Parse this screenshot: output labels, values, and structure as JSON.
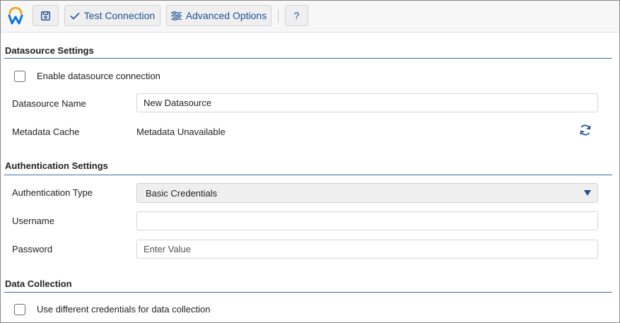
{
  "toolbar": {
    "save_icon": "save-icon",
    "test_connection_label": "Test Connection",
    "advanced_options_label": "Advanced Options",
    "help_label": "?"
  },
  "datasource_settings": {
    "title": "Datasource Settings",
    "enable_label": "Enable datasource connection",
    "enable_checked": false,
    "name_label": "Datasource Name",
    "name_value": "New Datasource",
    "metadata_label": "Metadata Cache",
    "metadata_value": "Metadata Unavailable"
  },
  "authentication_settings": {
    "title": "Authentication Settings",
    "type_label": "Authentication Type",
    "type_value": "Basic Credentials",
    "username_label": "Username",
    "username_value": "",
    "password_label": "Password",
    "password_placeholder": "Enter Value"
  },
  "data_collection": {
    "title": "Data Collection",
    "different_credentials_label": "Use different credentials for data collection",
    "different_credentials_checked": false
  },
  "colors": {
    "accent": "#1f4f96",
    "section_rule": "#3a6ea5",
    "logo_orange": "#f5a623",
    "logo_blue": "#0875e1"
  }
}
